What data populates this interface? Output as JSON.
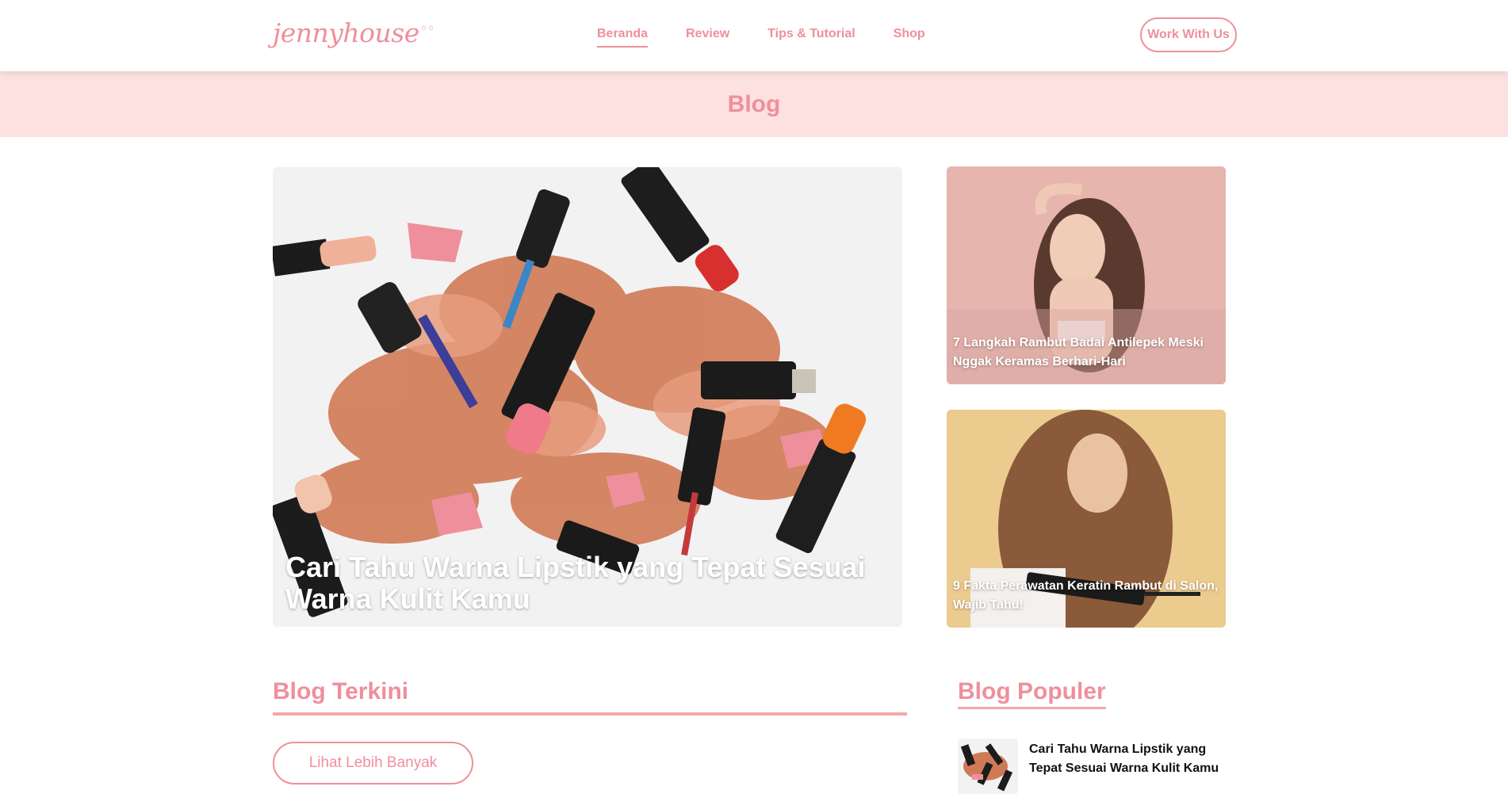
{
  "brand": {
    "logo_text": "jennyhouse",
    "accent_color": "#ef8f9b",
    "banner_color": "#fde0e0"
  },
  "nav": {
    "items": [
      {
        "label": "Beranda",
        "active": true
      },
      {
        "label": "Review"
      },
      {
        "label": "Tips & Tutorial"
      },
      {
        "label": "Shop"
      }
    ],
    "cta_label": "Work With Us"
  },
  "banner": {
    "title": "Blog"
  },
  "featured": {
    "main": {
      "title": "Cari Tahu Warna Lipstik yang Tepat Sesuai Warna Kulit Kamu",
      "image": "lipstick-makeup-photo"
    },
    "side": [
      {
        "title": "7 Langkah Rambut Badai Antilepek Meski Nggak Keramas Berhari-Hari",
        "image": "woman-hair-photo"
      },
      {
        "title": "9 Fakta Perawatan Keratin Rambut di Salon, Wajib Tahu!",
        "image": "woman-hair-straightener-photo"
      }
    ]
  },
  "terkini": {
    "title": "Blog Terkini",
    "more_label": "Lihat Lebih Banyak"
  },
  "populer": {
    "title": "Blog Populer",
    "items": [
      {
        "title": "Cari Tahu Warna Lipstik yang Tepat Sesuai Warna Kulit Kamu",
        "image": "lipstick-thumbnail"
      }
    ]
  }
}
